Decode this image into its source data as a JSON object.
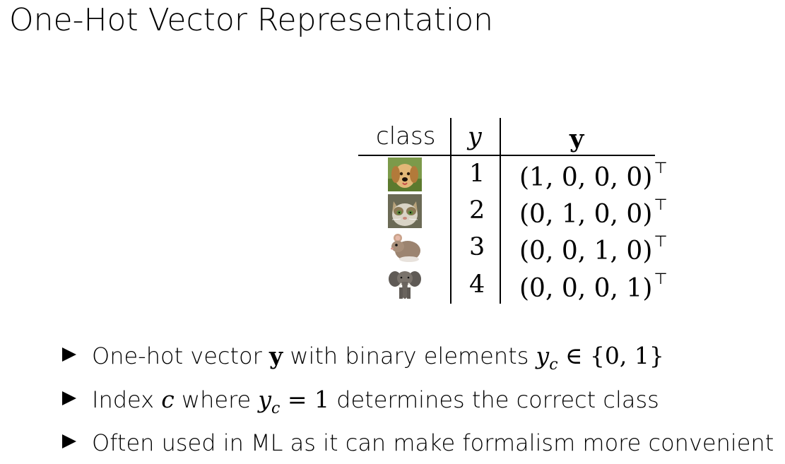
{
  "slide": {
    "title": "One-Hot Vector Representation"
  },
  "table": {
    "headers": {
      "class": "class",
      "y_scalar": "y",
      "y_vector": "y"
    },
    "rows": [
      {
        "image": "dog-photo",
        "label": "1",
        "vector": "(1, 0, 0, 0)",
        "transpose": "⊤"
      },
      {
        "image": "cat-photo",
        "label": "2",
        "vector": "(0, 1, 0, 0)",
        "transpose": "⊤"
      },
      {
        "image": "mouse-photo",
        "label": "3",
        "vector": "(0, 0, 1, 0)",
        "transpose": "⊤"
      },
      {
        "image": "elephant-photo",
        "label": "4",
        "vector": "(0, 0, 0, 1)",
        "transpose": "⊤"
      }
    ]
  },
  "bullets": [
    {
      "t1": "One-hot vector ",
      "m1": "y",
      "t2": " with binary elements ",
      "m2": "y",
      "m2sub": "c",
      "m3": " ∈ {0, 1}"
    },
    {
      "t1": "Index ",
      "m1": "c",
      "t2": " where ",
      "m2": "y",
      "m2sub": "c",
      "m3": " = 1",
      "t3": " determines the correct class"
    },
    {
      "t1": "Often used in ML as it can make formalism more convenient"
    }
  ]
}
